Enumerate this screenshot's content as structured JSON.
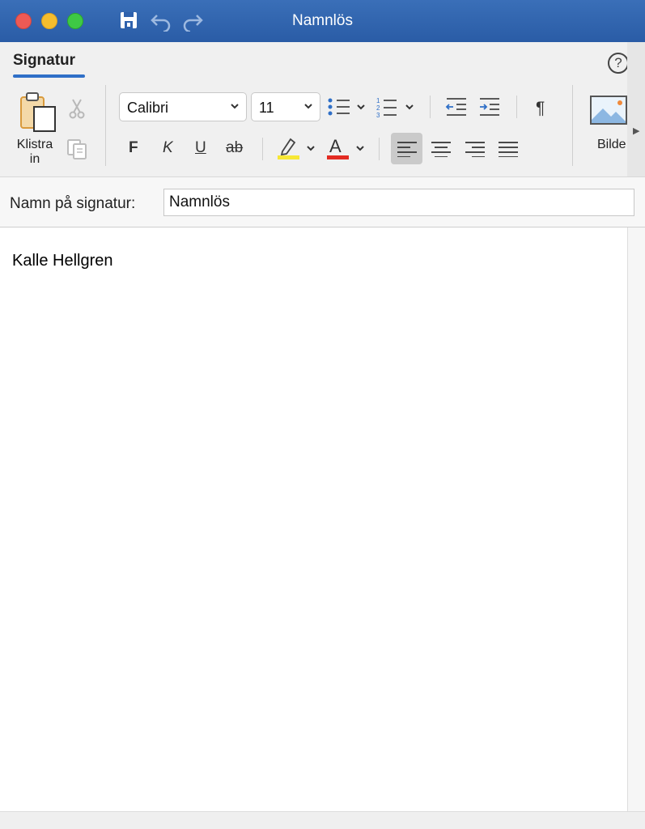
{
  "window": {
    "title": "Namnlös",
    "icons": [
      "save-icon",
      "undo-icon",
      "redo-icon"
    ]
  },
  "ribbon": {
    "tab": "Signatur",
    "help": "?",
    "paste": {
      "label": "Klistra\nin"
    },
    "font": {
      "family": "Calibri",
      "size": "11"
    },
    "format": {
      "bold": "F",
      "italic": "K",
      "underline": "U",
      "strikethrough": "ab",
      "font_color_letter": "A"
    },
    "paragraph_mark": "¶",
    "picture": {
      "label": "Bilde"
    },
    "colors": {
      "accent": "#2f6fc7",
      "highlight": "#f7e735",
      "font_color": "#e32b22"
    }
  },
  "signature": {
    "name_label": "Namn på signatur:",
    "name_value": "Namnlös"
  },
  "editor": {
    "content": "Kalle Hellgren"
  }
}
